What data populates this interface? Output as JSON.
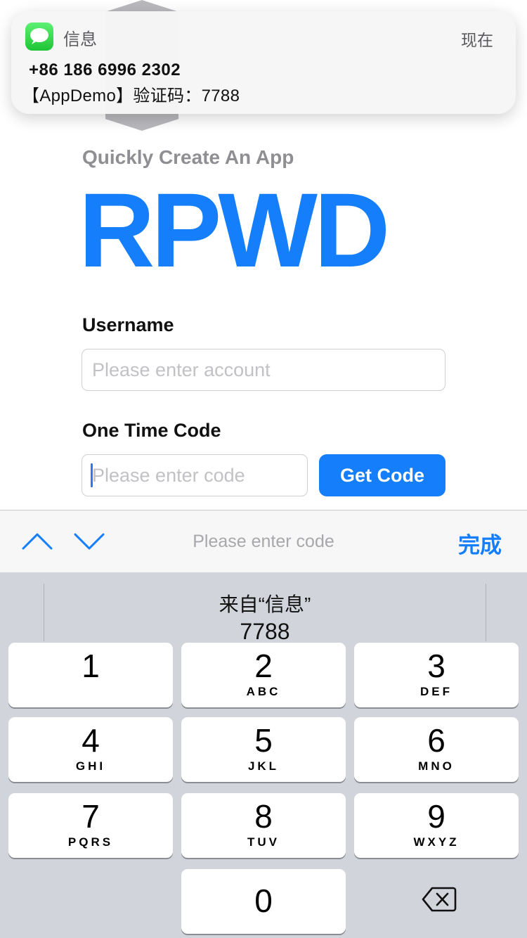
{
  "notification": {
    "app_name": "信息",
    "time": "现在",
    "sender": "+86 186 6996 2302",
    "body": "【AppDemo】验证码：7788",
    "app_icon": "messages-icon"
  },
  "page": {
    "subtitle": "Quickly Create An App",
    "brand_title": "RPWD",
    "brand_color": "#147EFB",
    "username_label": "Username",
    "username_placeholder": "Please enter account",
    "code_label": "One Time Code",
    "code_placeholder": "Please enter code",
    "get_code_label": "Get Code"
  },
  "accessory_bar": {
    "prev_icon": "chevron-up-icon",
    "next_icon": "chevron-down-icon",
    "placeholder": "Please enter code",
    "done_label": "完成"
  },
  "keyboard": {
    "suggestion_source": "来自“信息”",
    "suggestion_code": "7788",
    "keys": [
      {
        "digit": "1",
        "letters": ""
      },
      {
        "digit": "2",
        "letters": "ABC"
      },
      {
        "digit": "3",
        "letters": "DEF"
      },
      {
        "digit": "4",
        "letters": "GHI"
      },
      {
        "digit": "5",
        "letters": "JKL"
      },
      {
        "digit": "6",
        "letters": "MNO"
      },
      {
        "digit": "7",
        "letters": "PQRS"
      },
      {
        "digit": "8",
        "letters": "TUV"
      },
      {
        "digit": "9",
        "letters": "WXYZ"
      },
      {
        "digit": "0",
        "letters": ""
      }
    ],
    "delete_icon": "backspace-icon"
  }
}
